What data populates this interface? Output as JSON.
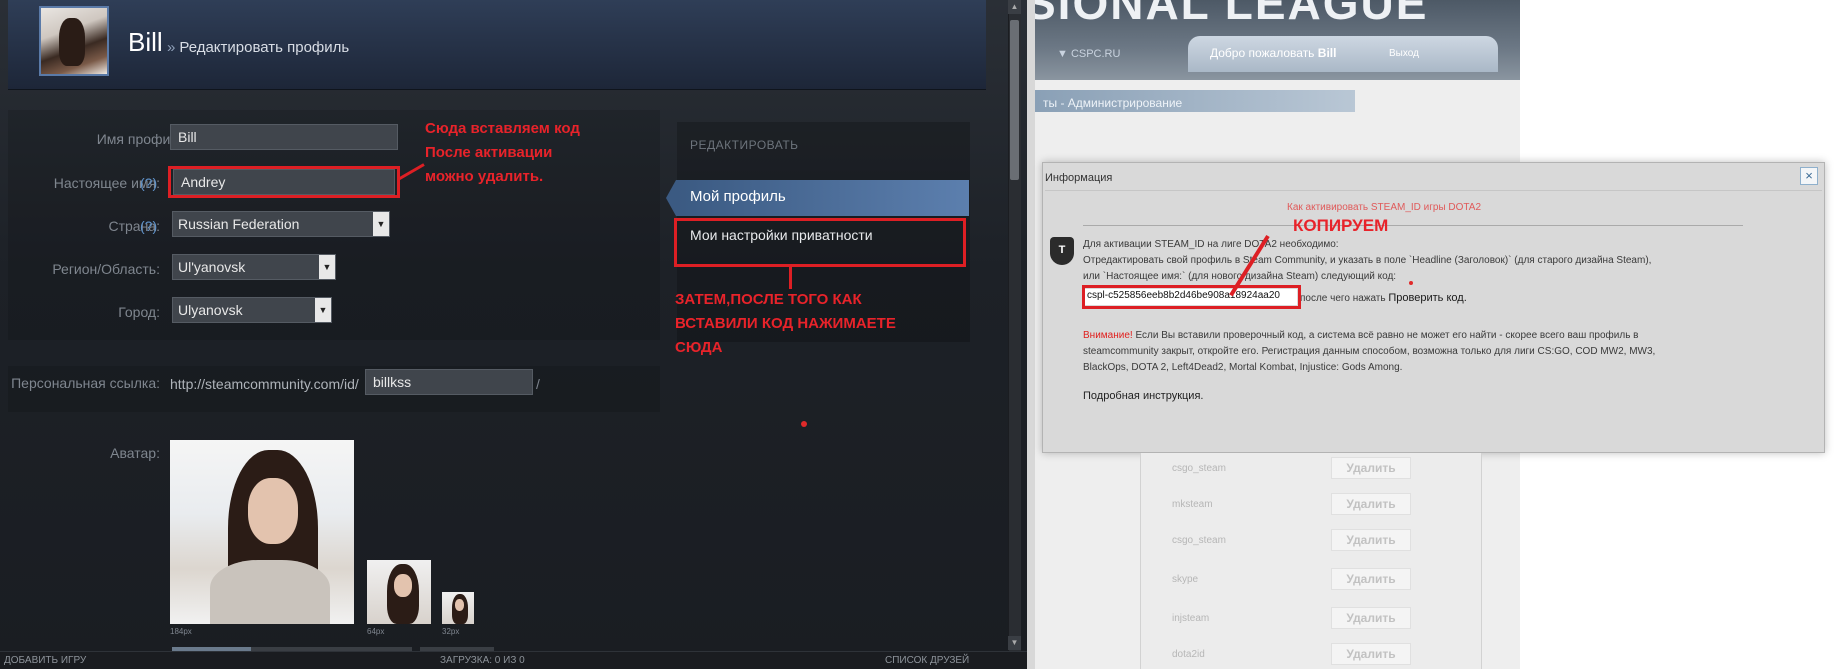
{
  "steam": {
    "header": {
      "name": "Bill",
      "separator": "»",
      "crumb": "Редактировать профиль"
    },
    "form": {
      "profile_name_label": "Имя профиля:",
      "profile_name_value": "Bill",
      "real_name_label": "Настоящее имя:",
      "real_name_help": "(?)",
      "real_name_value": "Andrey",
      "country_label": "Страна:",
      "country_help": "(?)",
      "country_value": "Russian Federation",
      "region_label": "Регион/Область:",
      "region_value": "Ul'yanovsk",
      "city_label": "Город:",
      "city_value": "Ulyanovsk",
      "url_label": "Персональная ссылка:",
      "url_prefix": "http://steamcommunity.com/id/",
      "url_value": "billkss",
      "url_suffix": "/",
      "avatar_label": "Аватар:",
      "size_184": "184px",
      "size_64": "64px",
      "size_32": "32px"
    },
    "menu": {
      "heading": "РЕДАКТИРОВАТЬ",
      "active": "Мой профиль",
      "privacy": "Мои настройки приватности"
    },
    "bottom": {
      "add_game": "ДОБАВИТЬ ИГРУ",
      "loading": "ЗАГРУЗКА: 0 ИЗ 0",
      "friends": "СПИСОК ДРУЗЕЙ"
    }
  },
  "annotations": {
    "insert_code": [
      "Сюда вставляем код",
      "После активации",
      "можно удалить."
    ],
    "then_click": [
      "ЗАТЕМ,ПОСЛЕ ТОГО КАК",
      "ВСТАВИЛИ КОД НАЖИМАЕТЕ",
      "СЮДА"
    ],
    "copy": "КОПИРУЕМ"
  },
  "site": {
    "banner": "SIONAL LEAGUE",
    "nav_link": "▼ CSPC.RU",
    "welcome_prefix": "Добро пожаловать",
    "welcome_user": "Bill",
    "logout": "Выход",
    "admin": "ты - Администрирование",
    "dialog": {
      "title": "Информация",
      "close": "×",
      "heading": "Как активировать STEAM_ID игры DOTA2",
      "line1": "Для активации STEAM_ID на лиге DOTA2 необходимо:",
      "line2": "Отредактировать свой профиль в Steam Community, и указать в поле `Headline (Заголовок)` (для старого дизайна Steam),",
      "line3": "или `Настоящее имя:` (для нового дизайна Steam) следующий код:",
      "code": "cspl-c525856eeb8b2d46be908a18924aa20",
      "after_code": "после чего нажать",
      "check_link": "Проверить код.",
      "warning_label": "Внимание!",
      "warning_text": "Если Вы вставили проверочный код, а система всё равно не может его найти - скорее всего ваш профиль в",
      "warning_line2": "steamcommunity закрыт, откройте его. Регистрация данным способом, возможна только для лиги CS:GO, COD MW2, MW3,",
      "warning_line3": "BlackOps, DOTA 2, Left4Dead2, Mortal Kombat, Injustice: Gods Among.",
      "detail": "Подробная инструкция."
    },
    "table": {
      "delete_label": "Удалить",
      "rows": [
        "csgo_steam",
        "mksteam",
        "csgo_steam",
        "skype",
        "injsteam",
        "dota2id"
      ]
    }
  },
  "colors": {
    "annotation_red": "#dd1f24",
    "steam_blue": "#5c7fae",
    "steam_bg": "#1d2127"
  }
}
